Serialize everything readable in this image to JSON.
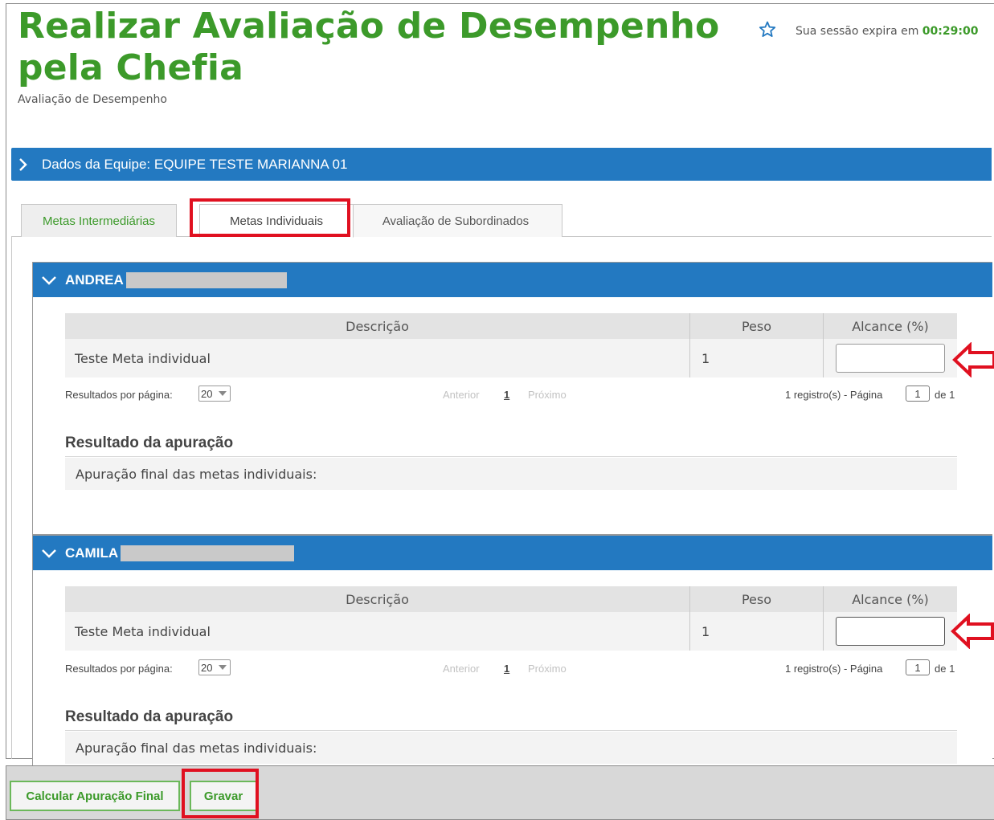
{
  "header": {
    "title": "Realizar Avaliação de Desempenho pela Chefia",
    "subtitle": "Avaliação de Desempenho",
    "session_label": "Sua sessão expira em",
    "session_time": "00:29:00"
  },
  "team": {
    "label": "Dados da Equipe: EQUIPE TESTE MARIANNA 01"
  },
  "tabs": [
    {
      "label": "Metas Intermediárias"
    },
    {
      "label": "Metas Individuais"
    },
    {
      "label": "Avaliação de Subordinados"
    }
  ],
  "table_headers": {
    "description": "Descrição",
    "weight": "Peso",
    "reach": "Alcance (%)"
  },
  "people": [
    {
      "name": "ANDREA",
      "row": {
        "description": "Teste Meta individual",
        "weight": "1",
        "reach": ""
      },
      "pager": {
        "rpp_label": "Resultados por página:",
        "rpp_value": "20",
        "prev": "Anterior",
        "page": "1",
        "next": "Próximo",
        "info": "1 registro(s) - Página",
        "page_box": "1",
        "of": "de 1"
      },
      "result_title": "Resultado da apuração",
      "result_text": "Apuração final das metas individuais:"
    },
    {
      "name": "CAMILA",
      "row": {
        "description": "Teste Meta individual",
        "weight": "1",
        "reach": ""
      },
      "pager": {
        "rpp_label": "Resultados por página:",
        "rpp_value": "20",
        "prev": "Anterior",
        "page": "1",
        "next": "Próximo",
        "info": "1 registro(s) - Página",
        "page_box": "1",
        "of": "de 1"
      },
      "result_title": "Resultado da apuração",
      "result_text": "Apuração final das metas individuais:"
    }
  ],
  "footer": {
    "calc_label": "Calcular Apuração Final",
    "save_label": "Gravar"
  },
  "colors": {
    "accent_green": "#3c9a2a",
    "bar_blue": "#2379c1",
    "highlight_red": "#e01020"
  }
}
